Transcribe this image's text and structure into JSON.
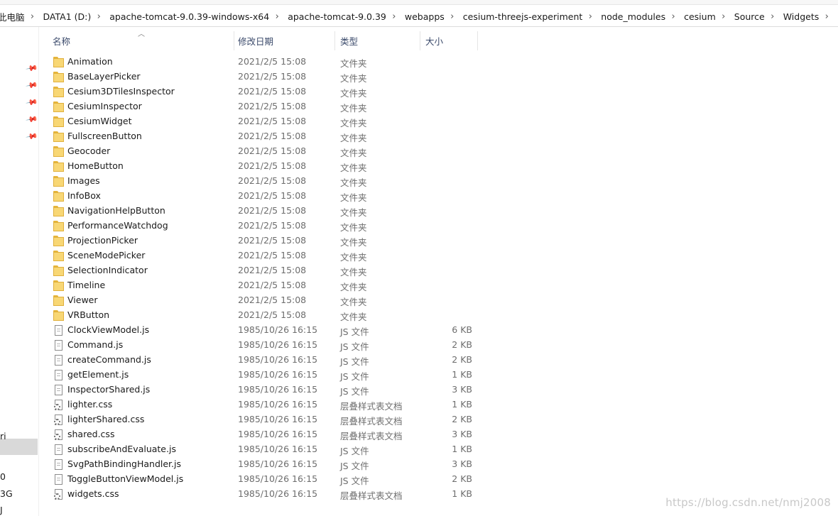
{
  "breadcrumb": [
    "此电脑",
    "DATA1 (D:)",
    "apache-tomcat-9.0.39-windows-x64",
    "apache-tomcat-9.0.39",
    "webapps",
    "cesium-threejs-experiment",
    "node_modules",
    "cesium",
    "Source",
    "Widgets"
  ],
  "nav_pane": {
    "fragments": [
      "ri",
      "0",
      "3G",
      "J"
    ]
  },
  "columns": {
    "name": "名称",
    "date": "修改日期",
    "type": "类型",
    "size": "大小"
  },
  "files": [
    {
      "name": "Animation",
      "date": "2021/2/5 15:08",
      "type": "文件夹",
      "size": "",
      "kind": "folder"
    },
    {
      "name": "BaseLayerPicker",
      "date": "2021/2/5 15:08",
      "type": "文件夹",
      "size": "",
      "kind": "folder"
    },
    {
      "name": "Cesium3DTilesInspector",
      "date": "2021/2/5 15:08",
      "type": "文件夹",
      "size": "",
      "kind": "folder"
    },
    {
      "name": "CesiumInspector",
      "date": "2021/2/5 15:08",
      "type": "文件夹",
      "size": "",
      "kind": "folder"
    },
    {
      "name": "CesiumWidget",
      "date": "2021/2/5 15:08",
      "type": "文件夹",
      "size": "",
      "kind": "folder"
    },
    {
      "name": "FullscreenButton",
      "date": "2021/2/5 15:08",
      "type": "文件夹",
      "size": "",
      "kind": "folder"
    },
    {
      "name": "Geocoder",
      "date": "2021/2/5 15:08",
      "type": "文件夹",
      "size": "",
      "kind": "folder"
    },
    {
      "name": "HomeButton",
      "date": "2021/2/5 15:08",
      "type": "文件夹",
      "size": "",
      "kind": "folder"
    },
    {
      "name": "Images",
      "date": "2021/2/5 15:08",
      "type": "文件夹",
      "size": "",
      "kind": "folder"
    },
    {
      "name": "InfoBox",
      "date": "2021/2/5 15:08",
      "type": "文件夹",
      "size": "",
      "kind": "folder"
    },
    {
      "name": "NavigationHelpButton",
      "date": "2021/2/5 15:08",
      "type": "文件夹",
      "size": "",
      "kind": "folder"
    },
    {
      "name": "PerformanceWatchdog",
      "date": "2021/2/5 15:08",
      "type": "文件夹",
      "size": "",
      "kind": "folder"
    },
    {
      "name": "ProjectionPicker",
      "date": "2021/2/5 15:08",
      "type": "文件夹",
      "size": "",
      "kind": "folder"
    },
    {
      "name": "SceneModePicker",
      "date": "2021/2/5 15:08",
      "type": "文件夹",
      "size": "",
      "kind": "folder"
    },
    {
      "name": "SelectionIndicator",
      "date": "2021/2/5 15:08",
      "type": "文件夹",
      "size": "",
      "kind": "folder"
    },
    {
      "name": "Timeline",
      "date": "2021/2/5 15:08",
      "type": "文件夹",
      "size": "",
      "kind": "folder"
    },
    {
      "name": "Viewer",
      "date": "2021/2/5 15:08",
      "type": "文件夹",
      "size": "",
      "kind": "folder"
    },
    {
      "name": "VRButton",
      "date": "2021/2/5 15:08",
      "type": "文件夹",
      "size": "",
      "kind": "folder"
    },
    {
      "name": "ClockViewModel.js",
      "date": "1985/10/26 16:15",
      "type": "JS 文件",
      "size": "6 KB",
      "kind": "js"
    },
    {
      "name": "Command.js",
      "date": "1985/10/26 16:15",
      "type": "JS 文件",
      "size": "2 KB",
      "kind": "js"
    },
    {
      "name": "createCommand.js",
      "date": "1985/10/26 16:15",
      "type": "JS 文件",
      "size": "2 KB",
      "kind": "js"
    },
    {
      "name": "getElement.js",
      "date": "1985/10/26 16:15",
      "type": "JS 文件",
      "size": "1 KB",
      "kind": "js"
    },
    {
      "name": "InspectorShared.js",
      "date": "1985/10/26 16:15",
      "type": "JS 文件",
      "size": "3 KB",
      "kind": "js"
    },
    {
      "name": "lighter.css",
      "date": "1985/10/26 16:15",
      "type": "层叠样式表文档",
      "size": "1 KB",
      "kind": "css"
    },
    {
      "name": "lighterShared.css",
      "date": "1985/10/26 16:15",
      "type": "层叠样式表文档",
      "size": "2 KB",
      "kind": "css"
    },
    {
      "name": "shared.css",
      "date": "1985/10/26 16:15",
      "type": "层叠样式表文档",
      "size": "3 KB",
      "kind": "css"
    },
    {
      "name": "subscribeAndEvaluate.js",
      "date": "1985/10/26 16:15",
      "type": "JS 文件",
      "size": "1 KB",
      "kind": "js"
    },
    {
      "name": "SvgPathBindingHandler.js",
      "date": "1985/10/26 16:15",
      "type": "JS 文件",
      "size": "3 KB",
      "kind": "js"
    },
    {
      "name": "ToggleButtonViewModel.js",
      "date": "1985/10/26 16:15",
      "type": "JS 文件",
      "size": "2 KB",
      "kind": "js"
    },
    {
      "name": "widgets.css",
      "date": "1985/10/26 16:15",
      "type": "层叠样式表文档",
      "size": "1 KB",
      "kind": "css"
    }
  ],
  "watermark": "https://blog.csdn.net/nmj2008"
}
